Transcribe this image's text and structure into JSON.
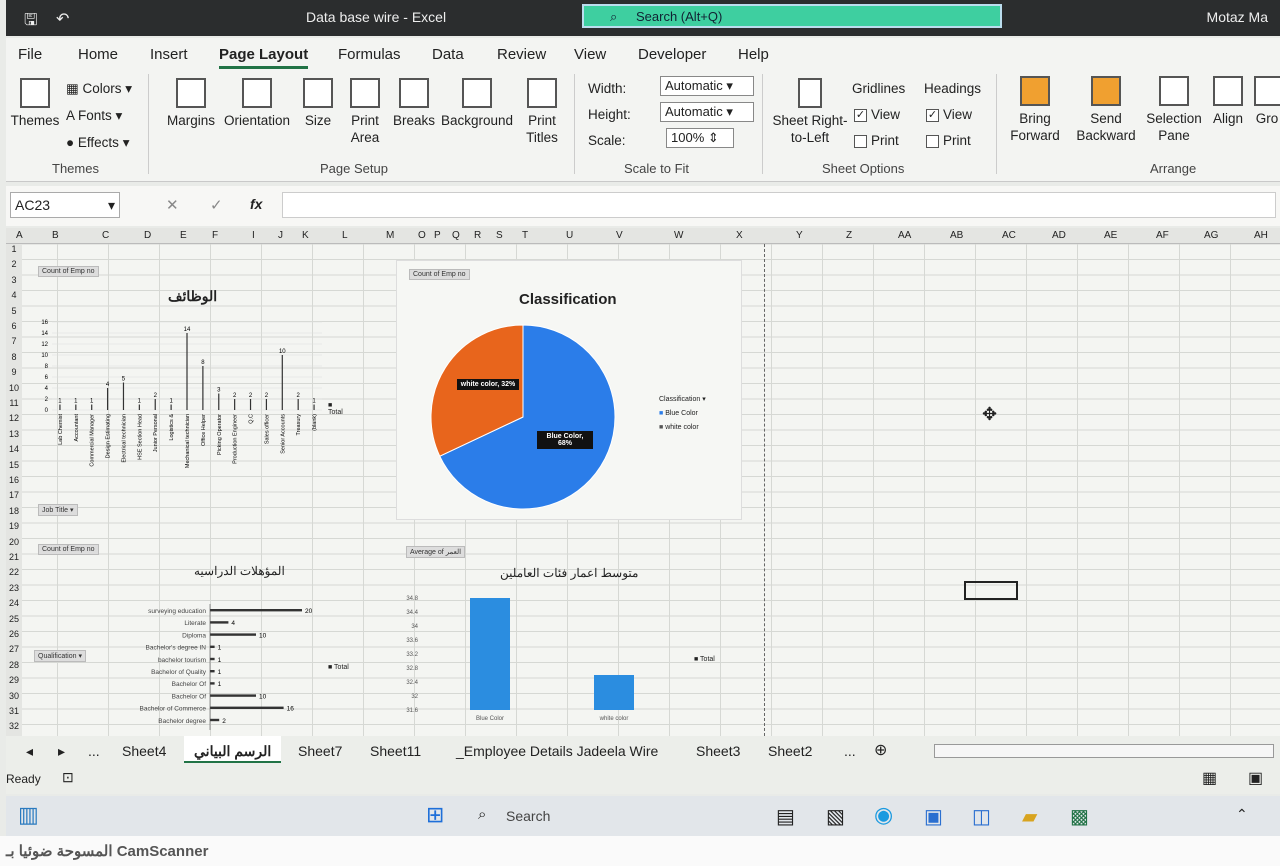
{
  "window": {
    "title": "Data base wire  -  Excel",
    "search": "Search (Alt+Q)",
    "user": "Motaz Ma"
  },
  "tabs": [
    "File",
    "Home",
    "Insert",
    "Page Layout",
    "Formulas",
    "Data",
    "Review",
    "View",
    "Developer",
    "Help"
  ],
  "ribbon": {
    "themes": {
      "themes": "Themes",
      "colors": "Colors",
      "fonts": "Fonts",
      "effects": "Effects",
      "group": "Themes"
    },
    "page_setup": {
      "margins": "Margins",
      "orientation": "Orientation",
      "size": "Size",
      "print_area": "Print Area",
      "breaks": "Breaks",
      "background": "Background",
      "print_titles": "Print Titles",
      "group": "Page Setup"
    },
    "scale": {
      "width": "Width:",
      "width_val": "Automatic",
      "height": "Height:",
      "height_val": "Automatic",
      "scale": "Scale:",
      "scale_val": "100%",
      "group": "Scale to Fit"
    },
    "sheet_options": {
      "rtl": "Sheet Right-to-Left",
      "gridlines": "Gridlines",
      "headings": "Headings",
      "view": "View",
      "print": "Print",
      "group": "Sheet Options"
    },
    "arrange": {
      "bring": "Bring Forward",
      "send": "Send Backward",
      "selection": "Selection Pane",
      "align": "Align",
      "group_btn": "Gro",
      "group": "Arrange"
    }
  },
  "formula": {
    "namebox": "AC23",
    "fx": "fx"
  },
  "columns": [
    "A",
    "B",
    "C",
    "D",
    "E",
    "F",
    "I",
    "J",
    "K",
    "L",
    "M",
    "O",
    "P",
    "Q",
    "R",
    "S",
    "T",
    "U",
    "V",
    "W",
    "X",
    "Y",
    "Z",
    "AA",
    "AB",
    "AC",
    "AD",
    "AE",
    "AF",
    "AG",
    "AH"
  ],
  "charts": {
    "jobs": {
      "btn": "Count of Emp no",
      "title": "الوظائف",
      "legend": "Total",
      "filter": "Job Title"
    },
    "classification": {
      "btn": "Count of Emp no",
      "title": "Classification",
      "legend_title": "Classification",
      "legend": [
        "Blue Color",
        "white color"
      ],
      "label_white": "white color, 32%",
      "label_blue": "Blue Color, 68%"
    },
    "qual": {
      "btn": "Count of Emp no",
      "title": "المؤهلات الدراسيه",
      "filter": "Qualification",
      "legend": "Total"
    },
    "age": {
      "btn": "Average of العمر",
      "title": "متوسط اعمار فئات العاملين",
      "legend": "Total"
    }
  },
  "chart_data": [
    {
      "type": "bar",
      "title": "الوظائف",
      "categories": [
        "Lab Chemist",
        "Accountant",
        "Commercial Manager",
        "Design Estimating",
        "Electrical technician",
        "HSE Section Head",
        "Junior Personal",
        "Logistics &",
        "Mechanical technician",
        "Office Helper",
        "Picking Operator",
        "Production Engineer",
        "Q.C",
        "Sales officer",
        "Senior Accounts",
        "Treasury",
        "(blank)"
      ],
      "values": [
        1,
        1,
        1,
        4,
        5,
        1,
        2,
        1,
        14,
        8,
        3,
        2,
        2,
        2,
        10,
        2,
        1
      ],
      "ylim": [
        0,
        16
      ]
    },
    {
      "type": "pie",
      "title": "Classification",
      "categories": [
        "Blue Color",
        "white color"
      ],
      "values": [
        68,
        32
      ],
      "colors": [
        "#2b7de9",
        "#e8651c"
      ]
    },
    {
      "type": "bar",
      "title": "المؤهلات الدراسيه",
      "categories": [
        "surveying education",
        "Literate",
        "Diploma",
        "Bachelor's degree IN",
        "bachelor tourism",
        "Bachelor of Quality",
        "Bachelor Of",
        "Bachelor Of",
        "Bachelor of Commerce",
        "Bachelor degree"
      ],
      "values": [
        20,
        4,
        10,
        1,
        1,
        1,
        1,
        10,
        16,
        2
      ]
    },
    {
      "type": "bar",
      "title": "متوسط اعمار فئات العاملين",
      "categories": [
        "Blue Color",
        "white color"
      ],
      "values": [
        34.8,
        32.6
      ],
      "ylim": [
        31.6,
        34.8
      ]
    }
  ],
  "sheets": [
    "Sheet4",
    "الرسم البياني",
    "Sheet7",
    "Sheet11",
    "_Employee Details Jadeela Wire",
    "Sheet3",
    "Sheet2"
  ],
  "sheet_nav": {
    "more": "...",
    "more2": "..."
  },
  "status": "Ready",
  "taskbar": {
    "search": "Search"
  },
  "footer": "المسوحة ضوئيا بـ CamScanner"
}
